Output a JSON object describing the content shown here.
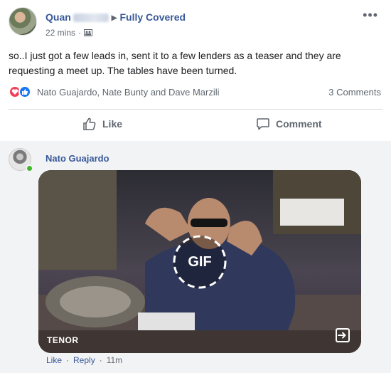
{
  "post": {
    "author_first": "Quan",
    "group": "Fully Covered",
    "time": "22 mins",
    "text": "so..I just got a few leads in, sent it to a few lenders as a teaser and they are requesting a meet up. The tables have been turned.",
    "reactors": "Nato Guajardo, Nate Bunty and Dave Marzili",
    "comments_count": "3 Comments",
    "actions": {
      "like": "Like",
      "comment": "Comment"
    }
  },
  "comment": {
    "author": "Nato Guajardo",
    "gif": {
      "badge": "GIF",
      "provider": "TENOR"
    },
    "actions": {
      "like": "Like",
      "reply": "Reply",
      "time": "11m"
    }
  },
  "colors": {
    "link": "#385898",
    "secondary": "#606770",
    "love": "#f33e58",
    "like": "#1877f2",
    "online": "#42b72a"
  },
  "icons": [
    "group-icon",
    "more-icon",
    "love-reaction-icon",
    "like-reaction-icon",
    "thumbs-up-icon",
    "speech-bubble-icon",
    "open-external-icon"
  ]
}
